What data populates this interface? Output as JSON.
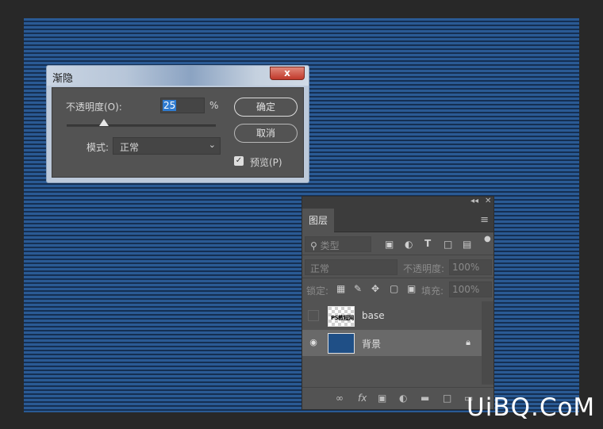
{
  "dialog": {
    "title": "渐隐",
    "close": "x",
    "opacity_label": "不透明度(O):",
    "opacity_value": "25",
    "percent": "%",
    "opacity_fraction": 0.25,
    "mode_label": "模式:",
    "mode_value": "正常",
    "ok": "确定",
    "cancel": "取消",
    "preview_label": "预览(P)",
    "preview_checked": true
  },
  "layers_panel": {
    "tab": "图层",
    "filter_label": "类型",
    "blend_mode": "正常",
    "opacity_label": "不透明度:",
    "opacity_value": "100%",
    "lock_label": "锁定:",
    "fill_label": "填充:",
    "fill_value": "100%",
    "layers": [
      {
        "name": "base",
        "visible": false,
        "thumb_text": "PS教程网"
      },
      {
        "name": "背景",
        "visible": true,
        "locked": true
      }
    ]
  },
  "icons": [
    "collapse-icon",
    "close-icon",
    "panel-menu-icon",
    "search-icon",
    "image-filter-icon",
    "adjustment-filter-icon",
    "type-filter-icon",
    "shape-filter-icon",
    "smart-object-filter-icon",
    "filter-toggle-icon",
    "lock-transparent-icon",
    "lock-paint-icon",
    "lock-position-icon",
    "lock-artboard-icon",
    "lock-all-icon",
    "eye-icon",
    "lock-icon",
    "link-icon",
    "fx-icon",
    "mask-icon",
    "adjustment-icon",
    "folder-icon",
    "new-layer-icon",
    "trash-icon",
    "chevron-down-icon"
  ],
  "watermark": "UiBQ.CoM"
}
